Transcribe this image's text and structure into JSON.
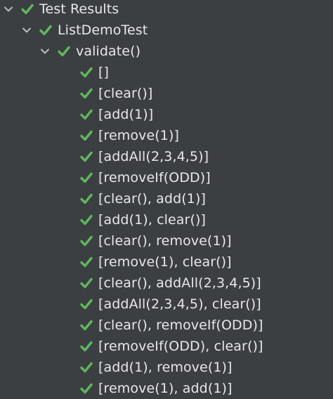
{
  "colors": {
    "background": "#3c3f41",
    "text": "#e6e8eb",
    "pass": "#5fb85c",
    "chevron": "#b9bcc0"
  },
  "root": {
    "label": "Test Results",
    "icon": "check-icon",
    "expanded": true
  },
  "suite": {
    "label": "ListDemoTest",
    "icon": "check-icon",
    "expanded": true
  },
  "method": {
    "label": "validate()",
    "icon": "check-icon",
    "expanded": true
  },
  "cases": [
    {
      "label": "[]"
    },
    {
      "label": "[clear()]"
    },
    {
      "label": "[add(1)]"
    },
    {
      "label": "[remove(1)]"
    },
    {
      "label": "[addAll(2,3,4,5)]"
    },
    {
      "label": "[removeIf(ODD)]"
    },
    {
      "label": "[clear(), add(1)]"
    },
    {
      "label": "[add(1), clear()]"
    },
    {
      "label": "[clear(), remove(1)]"
    },
    {
      "label": "[remove(1), clear()]"
    },
    {
      "label": "[clear(), addAll(2,3,4,5)]"
    },
    {
      "label": "[addAll(2,3,4,5), clear()]"
    },
    {
      "label": "[clear(), removeIf(ODD)]"
    },
    {
      "label": "[removeIf(ODD), clear()]"
    },
    {
      "label": "[add(1), remove(1)]"
    },
    {
      "label": "[remove(1), add(1)]"
    }
  ]
}
